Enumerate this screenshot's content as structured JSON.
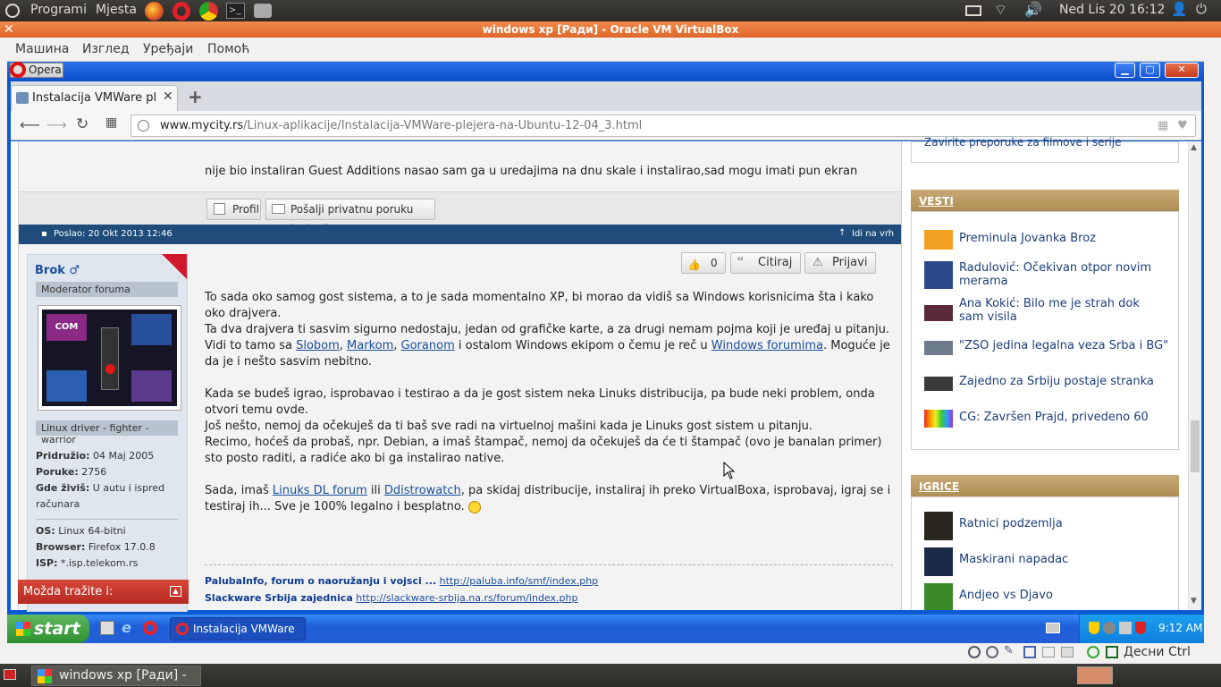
{
  "top_panel": {
    "apps": "Programi",
    "places": "Mjesta",
    "datetime": "Ned Lis 20 16:12"
  },
  "vbox": {
    "title": "windows xp [Ради] - Oracle VM VirtualBox",
    "menu": [
      "Машина",
      "Изглед",
      "Уређаји",
      "Помоћ"
    ],
    "host_key": "Десни Ctrl"
  },
  "opera": {
    "menu_label": "Opera"
  },
  "tab": {
    "title": "Instalacija VMWare plejera"
  },
  "address": {
    "domain": "www.mycity.rs",
    "path": "/Linux-aplikacije/Instalacija-VMWare-plejera-na-Ubuntu-12-04_3.html"
  },
  "prev_post": {
    "text": "nije bio instaliran Guest Additions nasao sam ga u uredajima na dnu skale i instalirao,sad mogu imati pun ekran",
    "profile_btn": "Profil",
    "pm_btn": "Pošalji privatnu poruku korisniku"
  },
  "post_bar": {
    "posted": "Poslao: 20 Okt 2013 12:46",
    "top_link": "Idi na vrh"
  },
  "actions": {
    "likes": "0",
    "quote": "Citiraj",
    "report": "Prijavi"
  },
  "user": {
    "name": "Brok ♂",
    "rank": "Moderator foruma",
    "title": "Linux driver - fighter - warrior",
    "joined_label": "Pridružio:",
    "joined": "04 Maj 2005",
    "posts_label": "Poruke:",
    "posts": "2756",
    "location_label": "Gde živiš:",
    "location": "U autu i ispred računara",
    "os_label": "OS:",
    "os": "Linux 64-bitni",
    "browser_label": "Browser:",
    "browser": "Firefox 17.0.8",
    "isp_label": "ISP:",
    "isp": "*.isp.telekom.rs",
    "avatar_text": "COM"
  },
  "body": {
    "p1a": "To sada oko samog gost sistema, a to je sada momentalno XP, bi morao da vidiš sa Windows korisnicima šta i kako oko drajvera.",
    "p1b": "Ta dva drajvera ti sasvim sigurno nedostaju, jedan od grafičke karte, a za drugi nemam pojma koji je uređaj u pitanju. Vidi to tamo sa ",
    "link1": "Slobom",
    "sep1": ", ",
    "link2": "Markom",
    "sep2": ", ",
    "link3": "Goranom",
    "p1c": " i ostalom Windows ekipom o čemu je reč u ",
    "link4": "Windows forumima",
    "p1d": ". Moguće je da je i nešto sasvim nebitno.",
    "p2a": "Kada se budeš igrao, isprobavao i testirao a da je gost sistem neka Linuks distribucija, pa bude neki problem, onda otvori temu ovde.",
    "p2b": "Još nešto, nemoj da očekuješ da ti baš sve radi na virtuelnoj mašini kada je Linuks gost sistem u pitanju.",
    "p2c": "Recimo, hoćeš da probaš, npr. Debian, a imaš štampač, nemoj da očekuješ da će ti štampač (ovo je banalan primer) sto posto raditi, a radiće ako bi ga instalirao native.",
    "p3a": "Sada, imaš ",
    "link5": "Linuks DL forum",
    "p3b": " ili ",
    "link6": "Ddistrowatch",
    "p3c": ", pa skidaj distribucije, instaliraj ih preko VirtualBoxa, isprobavaj, igraj se i testiraj ih... Sve je 100% legalno i besplatno. "
  },
  "signature": [
    {
      "label": "PalubaInfo, forum o naoružanju i vojsci ...",
      "url": "http://paluba.info/smf/index.php"
    },
    {
      "label": "Slackware Srbija zajednica",
      "url": "http://slackware-srbija.na.rs/forum/index.php"
    }
  ],
  "maybe": {
    "label": "Možda tražite i:"
  },
  "sidebar": {
    "top_item": "Zavirite preporuke za filmove i serije",
    "news_title": "VESTI",
    "news": [
      "Preminula Jovanka Broz",
      "Radulović: Očekivan otpor novim merama",
      "Ana Kokić: Bilo me je strah dok sam visila",
      "\"ZSO jedina legalna veza Srba i BG\"",
      "Zajedno za Srbiju postaje stranka",
      "CG: Završen Prajd, privedeno 60"
    ],
    "games_title": "IGRICE",
    "games": [
      "Ratnici podzemlja",
      "Maskirani napadac",
      "Andjeo vs Djavo"
    ]
  },
  "xp_taskbar": {
    "start": "start",
    "task": "Instalacija VMWare pl...",
    "clock": "9:12 AM"
  },
  "ubuntu_task": {
    "label": "windows xp [Ради] - ..."
  },
  "colors": {
    "accent_orange": "#e0662a",
    "xp_blue": "#245ed6",
    "news_header": "#b08e55",
    "link": "#1a4e9b"
  }
}
